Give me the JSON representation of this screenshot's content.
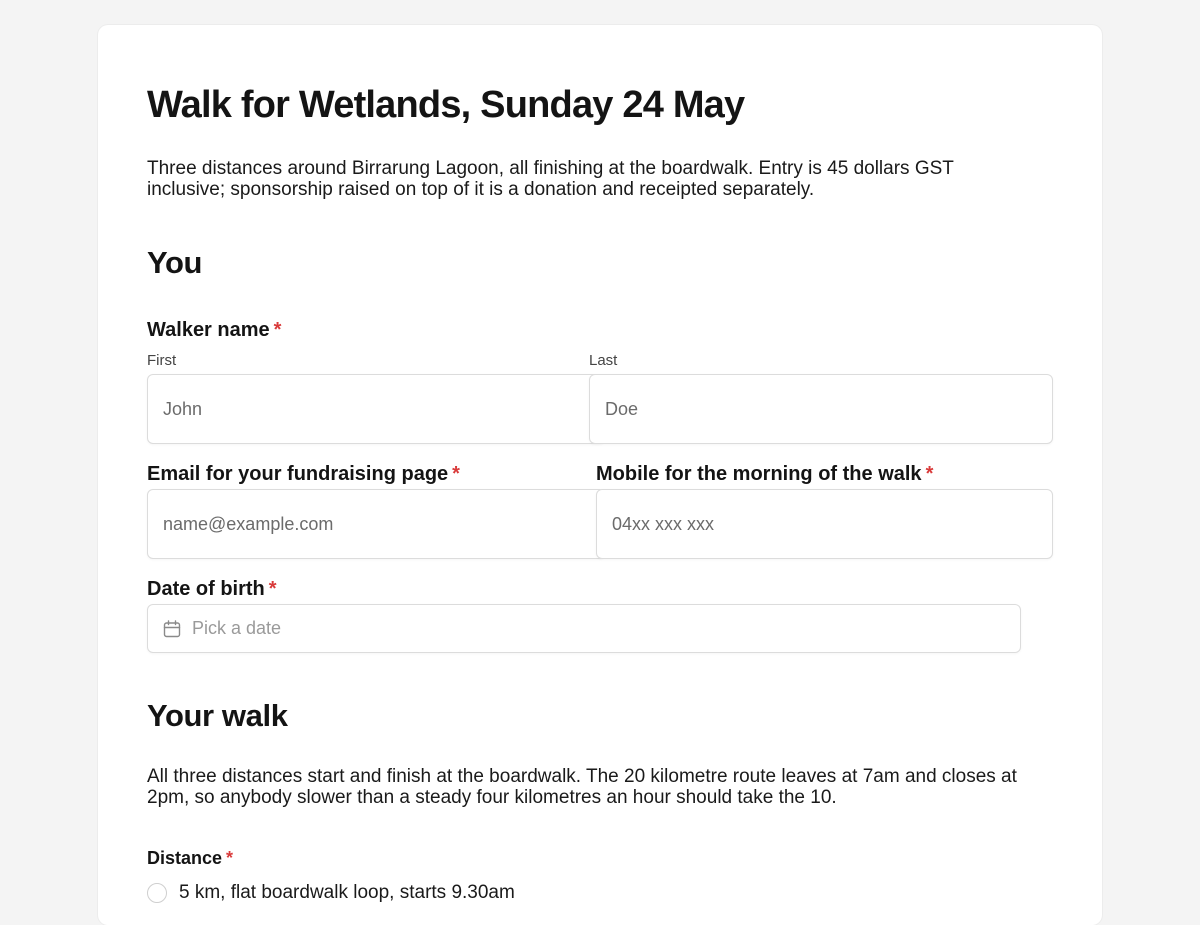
{
  "form": {
    "title": "Walk for Wetlands, Sunday 24 May",
    "intro": "Three distances around Birrarung Lagoon, all finishing at the boardwalk. Entry is 45 dollars GST inclusive; sponsorship raised on top of it is a donation and receipted separately.",
    "required_marker": "*"
  },
  "section_you": {
    "heading": "You",
    "walker_name": {
      "label": "Walker name",
      "first": {
        "sublabel": "First",
        "placeholder": "John"
      },
      "last": {
        "sublabel": "Last",
        "placeholder": "Doe"
      }
    },
    "email": {
      "label": "Email for your fundraising page",
      "placeholder": "name@example.com"
    },
    "mobile": {
      "label": "Mobile for the morning of the walk",
      "placeholder": "04xx xxx xxx"
    },
    "dob": {
      "label": "Date of birth",
      "placeholder": "Pick a date",
      "icon": "calendar-icon"
    }
  },
  "section_walk": {
    "heading": "Your walk",
    "description": "All three distances start and finish at the boardwalk. The 20 kilometre route leaves at 7am and closes at 2pm, so anybody slower than a steady four kilometres an hour should take the 10.",
    "distance": {
      "label": "Distance",
      "options": [
        {
          "label": "5 km, flat boardwalk loop, starts 9.30am"
        }
      ]
    }
  },
  "colors": {
    "background": "#f4f4f4",
    "card": "#ffffff",
    "required": "#d93a3a",
    "border": "#dcdcdc"
  }
}
